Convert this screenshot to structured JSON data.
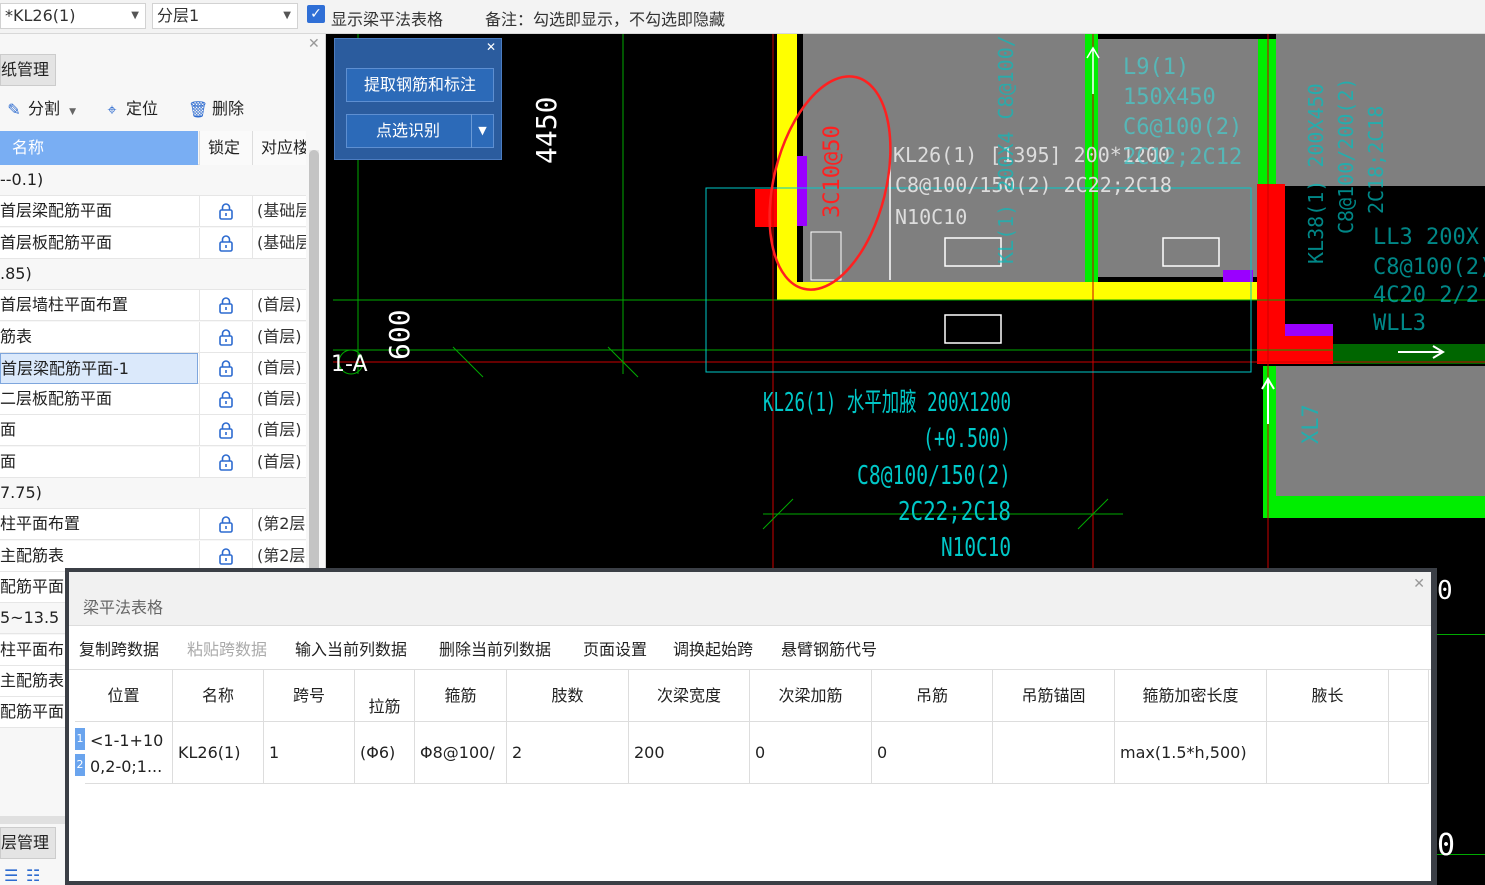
{
  "toolbar": {
    "drawing_select": "*KL26(1)",
    "layer_select": "分层1",
    "show_table_label": "显示梁平法表格",
    "note": "备注：勾选即显示，不勾选即隐藏",
    "checked": true
  },
  "left_panel": {
    "tab_label": "纸管理",
    "tools": [
      "分割",
      "定位",
      "删除"
    ],
    "columns": {
      "name": "名称",
      "lock": "锁定",
      "correspond": "对应楼"
    },
    "rows": [
      {
        "name": "--0.1)",
        "group": true,
        "corr": ""
      },
      {
        "name": "首层梁配筋平面",
        "group": false,
        "corr": "(基础层)"
      },
      {
        "name": "首层板配筋平面",
        "group": false,
        "corr": "(基础层)"
      },
      {
        "name": ".85)",
        "group": true,
        "corr": ""
      },
      {
        "name": "首层墙柱平面布置",
        "group": false,
        "corr": "(首层)"
      },
      {
        "name": "筋表",
        "group": false,
        "corr": "(首层)"
      },
      {
        "name": "首层梁配筋平面-1",
        "group": false,
        "corr": "(首层)",
        "selected": true
      },
      {
        "name": "二层板配筋平面",
        "group": false,
        "corr": "(首层)"
      },
      {
        "name": "面",
        "group": false,
        "corr": "(首层)"
      },
      {
        "name": "面",
        "group": false,
        "corr": "(首层)"
      },
      {
        "name": "7.75)",
        "group": true,
        "corr": ""
      },
      {
        "name": "柱平面布置",
        "group": false,
        "corr": "(第2层)"
      },
      {
        "name": "主配筋表",
        "group": false,
        "corr": "(第2层)"
      },
      {
        "name": "配筋平面",
        "group": false,
        "corr": ""
      },
      {
        "name": "5~13.5",
        "group": true,
        "corr": ""
      },
      {
        "name": "柱平面布",
        "group": false,
        "corr": ""
      },
      {
        "name": "主配筋表",
        "group": false,
        "corr": ""
      },
      {
        "name": "配筋平面",
        "group": false,
        "corr": ""
      }
    ],
    "bottom_tab_label": "层管理"
  },
  "float_panel": {
    "extract_button": "提取钢筋和标注",
    "pick_button": "点选识别"
  },
  "cad": {
    "dim_4450": "4450",
    "dim_600": "600",
    "axis_label": "1-A",
    "red_text": "3C10@50",
    "white_annot": [
      "KL26(1) [1395] 200*1200",
      "C8@100/150(2) 2C22;2C18",
      "N10C10"
    ],
    "cyan_annot": [
      "KL26(1) 水平加腋 200X1200",
      "(+0.500)",
      "C8@100/150(2)",
      "2C22;2C18",
      "N10C10"
    ],
    "lt_top": [
      "L9(1)",
      "150X450",
      "C6@100(2)",
      "2C12;2C12"
    ],
    "vert_left": "KL(1) 200X4 C8@100/200(2) 2C14",
    "vert_right": [
      "KL38(1) 200X450",
      "C8@100/200(2)",
      "2C18;2C18"
    ],
    "right_text": [
      "LL3 200X",
      "C8@100(2)",
      "4C20 2/2",
      "WLL3"
    ],
    "xl_text": "XL7",
    "edge_text": [
      "0",
      "0"
    ],
    "colors": {
      "yellow": "#ffff00",
      "green": "#00ff00",
      "red": "#ff0000",
      "purple": "#9900ff",
      "gray": "#808080",
      "cyan": "#00c8c8"
    }
  },
  "dialog": {
    "title": "梁平法表格",
    "menu": [
      {
        "label": "复制跨数据",
        "disabled": false
      },
      {
        "label": "粘贴跨数据",
        "disabled": true
      },
      {
        "label": "输入当前列数据",
        "disabled": false
      },
      {
        "label": "删除当前列数据",
        "disabled": false
      },
      {
        "label": "页面设置",
        "disabled": false
      },
      {
        "label": "调换起始跨",
        "disabled": false
      },
      {
        "label": "悬臂钢筋代号",
        "disabled": false
      }
    ],
    "headers": [
      "位置",
      "名称",
      "跨号",
      "拉筋",
      "箍筋",
      "肢数",
      "次梁宽度",
      "次梁加筋",
      "吊筋",
      "吊筋锚固",
      "箍筋加密长度",
      "腋长"
    ],
    "row": {
      "position_line1": "<1-1+10",
      "position_line2": "0,2-0;1...",
      "name": "KL26(1)",
      "span": "1",
      "tie": "(Φ6)",
      "stirrup": "Φ8@100/",
      "legs": "2",
      "sec_width": "200",
      "sec_add": "0",
      "hanger": "0",
      "hanger_anchor": "",
      "dense_len": "max(1.5*h,500)",
      "haunch": ""
    },
    "row_marks": [
      "1",
      "2"
    ]
  }
}
